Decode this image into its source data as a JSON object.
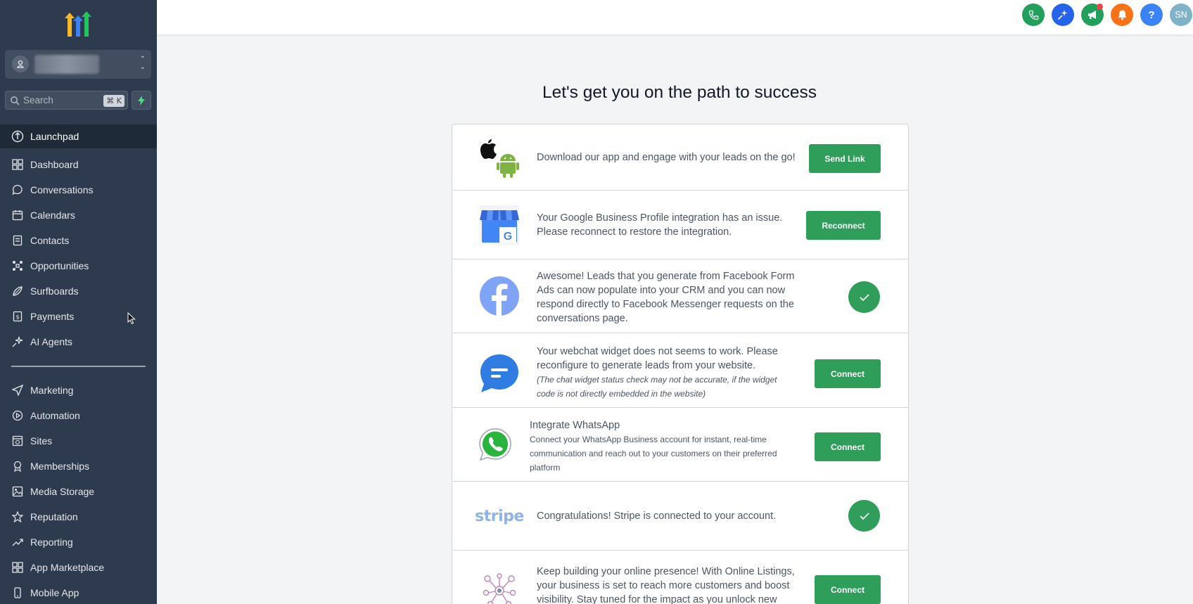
{
  "sidebar": {
    "search_placeholder": "Search",
    "search_shortcut": "⌘ K",
    "nav_items": [
      {
        "label": "Launchpad",
        "icon": "launchpad-icon",
        "active": true
      },
      {
        "label": "Dashboard",
        "icon": "dashboard-icon"
      },
      {
        "label": "Conversations",
        "icon": "chat-icon"
      },
      {
        "label": "Calendars",
        "icon": "calendar-icon"
      },
      {
        "label": "Contacts",
        "icon": "contacts-icon"
      },
      {
        "label": "Opportunities",
        "icon": "opportunities-icon"
      },
      {
        "label": "Surfboards",
        "icon": "surfboard-icon"
      },
      {
        "label": "Payments",
        "icon": "payments-icon"
      },
      {
        "label": "AI Agents",
        "icon": "sparkle-icon"
      }
    ],
    "nav_items_secondary": [
      {
        "label": "Marketing",
        "icon": "send-icon"
      },
      {
        "label": "Automation",
        "icon": "automation-icon"
      },
      {
        "label": "Sites",
        "icon": "sites-icon"
      },
      {
        "label": "Memberships",
        "icon": "membership-icon"
      },
      {
        "label": "Media Storage",
        "icon": "image-icon"
      },
      {
        "label": "Reputation",
        "icon": "star-icon"
      },
      {
        "label": "Reporting",
        "icon": "trend-icon"
      },
      {
        "label": "App Marketplace",
        "icon": "grid-icon"
      },
      {
        "label": "Mobile App",
        "icon": "phone-icon"
      }
    ]
  },
  "topbar": {
    "avatar_initials": "SN",
    "help_label": "?",
    "colors": {
      "phone": "#22a05b",
      "magic": "#2563eb",
      "announce": "#22a05b",
      "bell": "#f97316",
      "help": "#3b82f6",
      "avatar": "#7fb3c8"
    }
  },
  "main": {
    "title": "Let's get you on the path to success",
    "rows": [
      {
        "icon": "apple-android-icon",
        "text": "Download our app and engage with your leads on the go!",
        "action": "Send Link"
      },
      {
        "icon": "google-business-icon",
        "text_lines": [
          "Your Google Business Profile integration has an issue.",
          "Please reconnect to restore the integration."
        ],
        "action": "Reconnect"
      },
      {
        "icon": "facebook-icon",
        "text_lines": [
          "Awesome! Leads that you generate from Facebook Form",
          "Ads can now populate into your CRM and you can now",
          "respond directly to Facebook Messenger requests on the",
          "conversations page."
        ],
        "status": "connected"
      },
      {
        "icon": "webchat-icon",
        "text_lines": [
          "Your webchat widget does not seems to work. Please",
          "reconfigure to generate leads from your website."
        ],
        "note_lines": [
          "(The chat widget status check may not be accurate, if the widget",
          "code is not directly embedded in the website)"
        ],
        "action": "Connect"
      },
      {
        "icon": "whatsapp-icon",
        "heading": "Integrate WhatsApp",
        "desc_lines": [
          "Connect your WhatsApp Business account for instant, real-time",
          "communication and reach out to your customers on their preferred",
          "platform"
        ],
        "action": "Connect"
      },
      {
        "icon": "stripe-icon",
        "brand_text": "stripe",
        "text": "Congratulations! Stripe is connected to your account.",
        "status": "connected"
      },
      {
        "icon": "online-listings-icon",
        "text_lines": [
          "Keep building your online presence! With Online Listings,",
          "your business is set to reach more customers and boost",
          "visibility. Stay tuned for the impact as you unlock new"
        ],
        "action": "Connect"
      }
    ]
  }
}
